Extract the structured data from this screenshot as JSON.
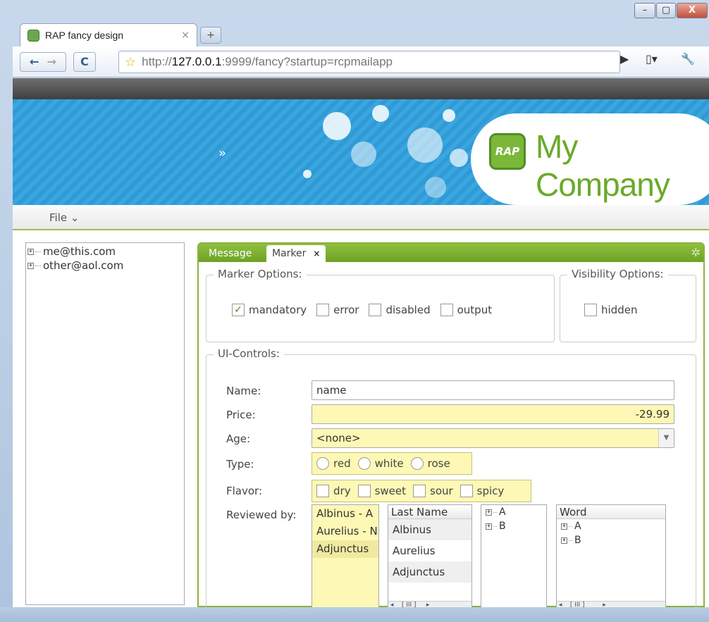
{
  "browser": {
    "tab_title": "RAP fancy design",
    "tab_close": "×",
    "new_tab": "+",
    "url_prefix": "http://",
    "url_host": "127.0.0.1",
    "url_rest": ":9999/fancy?startup=rcpmailapp",
    "window_controls": [
      "–",
      "▢",
      "X"
    ]
  },
  "banner": {
    "logo_badge": "RAP",
    "company": "My Company",
    "arrow": "»"
  },
  "menu": {
    "file": "File ⌄"
  },
  "tree": {
    "items": [
      "me@this.com",
      "other@aol.com"
    ]
  },
  "editor": {
    "tabs": [
      "Message",
      "Marker"
    ],
    "close": "×",
    "marker_options": {
      "title": "Marker Options:",
      "checks": [
        {
          "label": "mandatory",
          "checked": true
        },
        {
          "label": "error",
          "checked": false
        },
        {
          "label": "disabled",
          "checked": false
        },
        {
          "label": "output",
          "checked": false
        }
      ]
    },
    "visibility_options": {
      "title": "Visibility Options:",
      "hidden": "hidden"
    },
    "ui_controls": {
      "title": "UI-Controls:",
      "name_label": "Name:",
      "name_value": "name",
      "price_label": "Price:",
      "price_value": "-29.99",
      "age_label": "Age:",
      "age_value": "<none>",
      "type_label": "Type:",
      "types": [
        "red",
        "white",
        "rose"
      ],
      "flavor_label": "Flavor:",
      "flavors": [
        "dry",
        "sweet",
        "sour",
        "spicy"
      ],
      "reviewed_label": "Reviewed by:",
      "reviewers_list": [
        "Albinus - A",
        "Aurelius - N",
        "Adjunctus"
      ],
      "table_header": "Last Name",
      "table_rows": [
        "Albinus",
        "Aurelius",
        "Adjunctus"
      ],
      "tree1": [
        "A",
        "B"
      ],
      "tree2_header": "Word",
      "tree2": [
        "A",
        "B"
      ]
    }
  }
}
